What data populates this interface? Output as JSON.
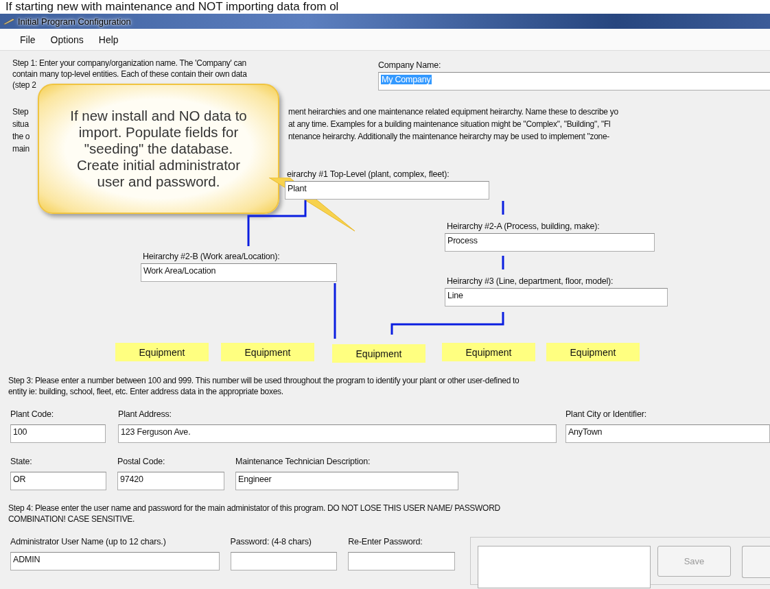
{
  "caption": "If starting new with maintenance and NOT importing data from ol",
  "window": {
    "title": "Initial Program Configuration"
  },
  "menu": [
    {
      "label": "File"
    },
    {
      "label": "Options"
    },
    {
      "label": "Help"
    }
  ],
  "step1": {
    "lines": [
      "Step 1: Enter your company/organization name. The 'Company' can",
      "contain many top-level entities. Each of these contain their own data",
      "(step 2"
    ],
    "company_label": "Company Name:",
    "company_value": "My Company",
    "company_value_highlighted": true
  },
  "step2": {
    "left_lines": [
      "Step",
      "situa",
      "the o",
      "main"
    ],
    "right_lines": [
      "ment heirarchies and one maintenance related equipment heirarchy. Name these to describe yo",
      "at any time. Examples for a building maintenance situation might be \"Complex\", \"Building\", \"Fl",
      "ntenance heirarchy. Additionally the maintenance heirarchy may be used to implement \"zone-"
    ]
  },
  "callout": {
    "text": "If new install and NO data to import. Populate fields for \"seeding\" the database. Create initial administrator user and password."
  },
  "hierarchy": [
    {
      "label": "eirarchy #1 Top-Level (plant, complex, fleet):",
      "value": "Plant"
    },
    {
      "label": "Heirarchy #2-A (Process, building, make):",
      "value": "Process"
    },
    {
      "label": "Heirarchy #2-B (Work area/Location):",
      "value": "Work Area/Location"
    },
    {
      "label": "Heirarchy #3 (Line, department, floor, model):",
      "value": "Line"
    }
  ],
  "equipment": [
    "Equipment",
    "Equipment",
    "Equipment",
    "Equipment",
    "Equipment"
  ],
  "step3": {
    "lines": [
      "Step 3: Please enter a number between 100 and 999. This number will be used throughout the program to identify your plant or other user-defined to",
      "entity ie: building, school, fleet, etc. Enter address data in the appropriate boxes."
    ],
    "rows": [
      [
        {
          "label": "Plant Code:",
          "value": "100"
        },
        {
          "label": "Plant Address:",
          "value": "123 Ferguson Ave."
        },
        {
          "label": "Plant City or Identifier:",
          "value": "AnyTown"
        }
      ],
      [
        {
          "label": "State:",
          "value": "OR"
        },
        {
          "label": "Postal Code:",
          "value": "97420"
        },
        {
          "label": "Maintenance Technician Description:",
          "value": "Engineer"
        }
      ]
    ]
  },
  "step4": {
    "lines": [
      "Step 4: Please enter the user name and password for the main administator of this program. DO NOT LOSE THIS USER NAME/ PASSWORD",
      "COMBINATION! CASE SENSITIVE."
    ],
    "fields": [
      {
        "label": "Administrator User Name (up to 12 chars.)",
        "value": "ADMIN"
      },
      {
        "label": "Password: (4-8 chars)"
      },
      {
        "label": "Re-Enter Password:"
      }
    ]
  },
  "save_button": {
    "label": "Save",
    "disabled": true
  }
}
